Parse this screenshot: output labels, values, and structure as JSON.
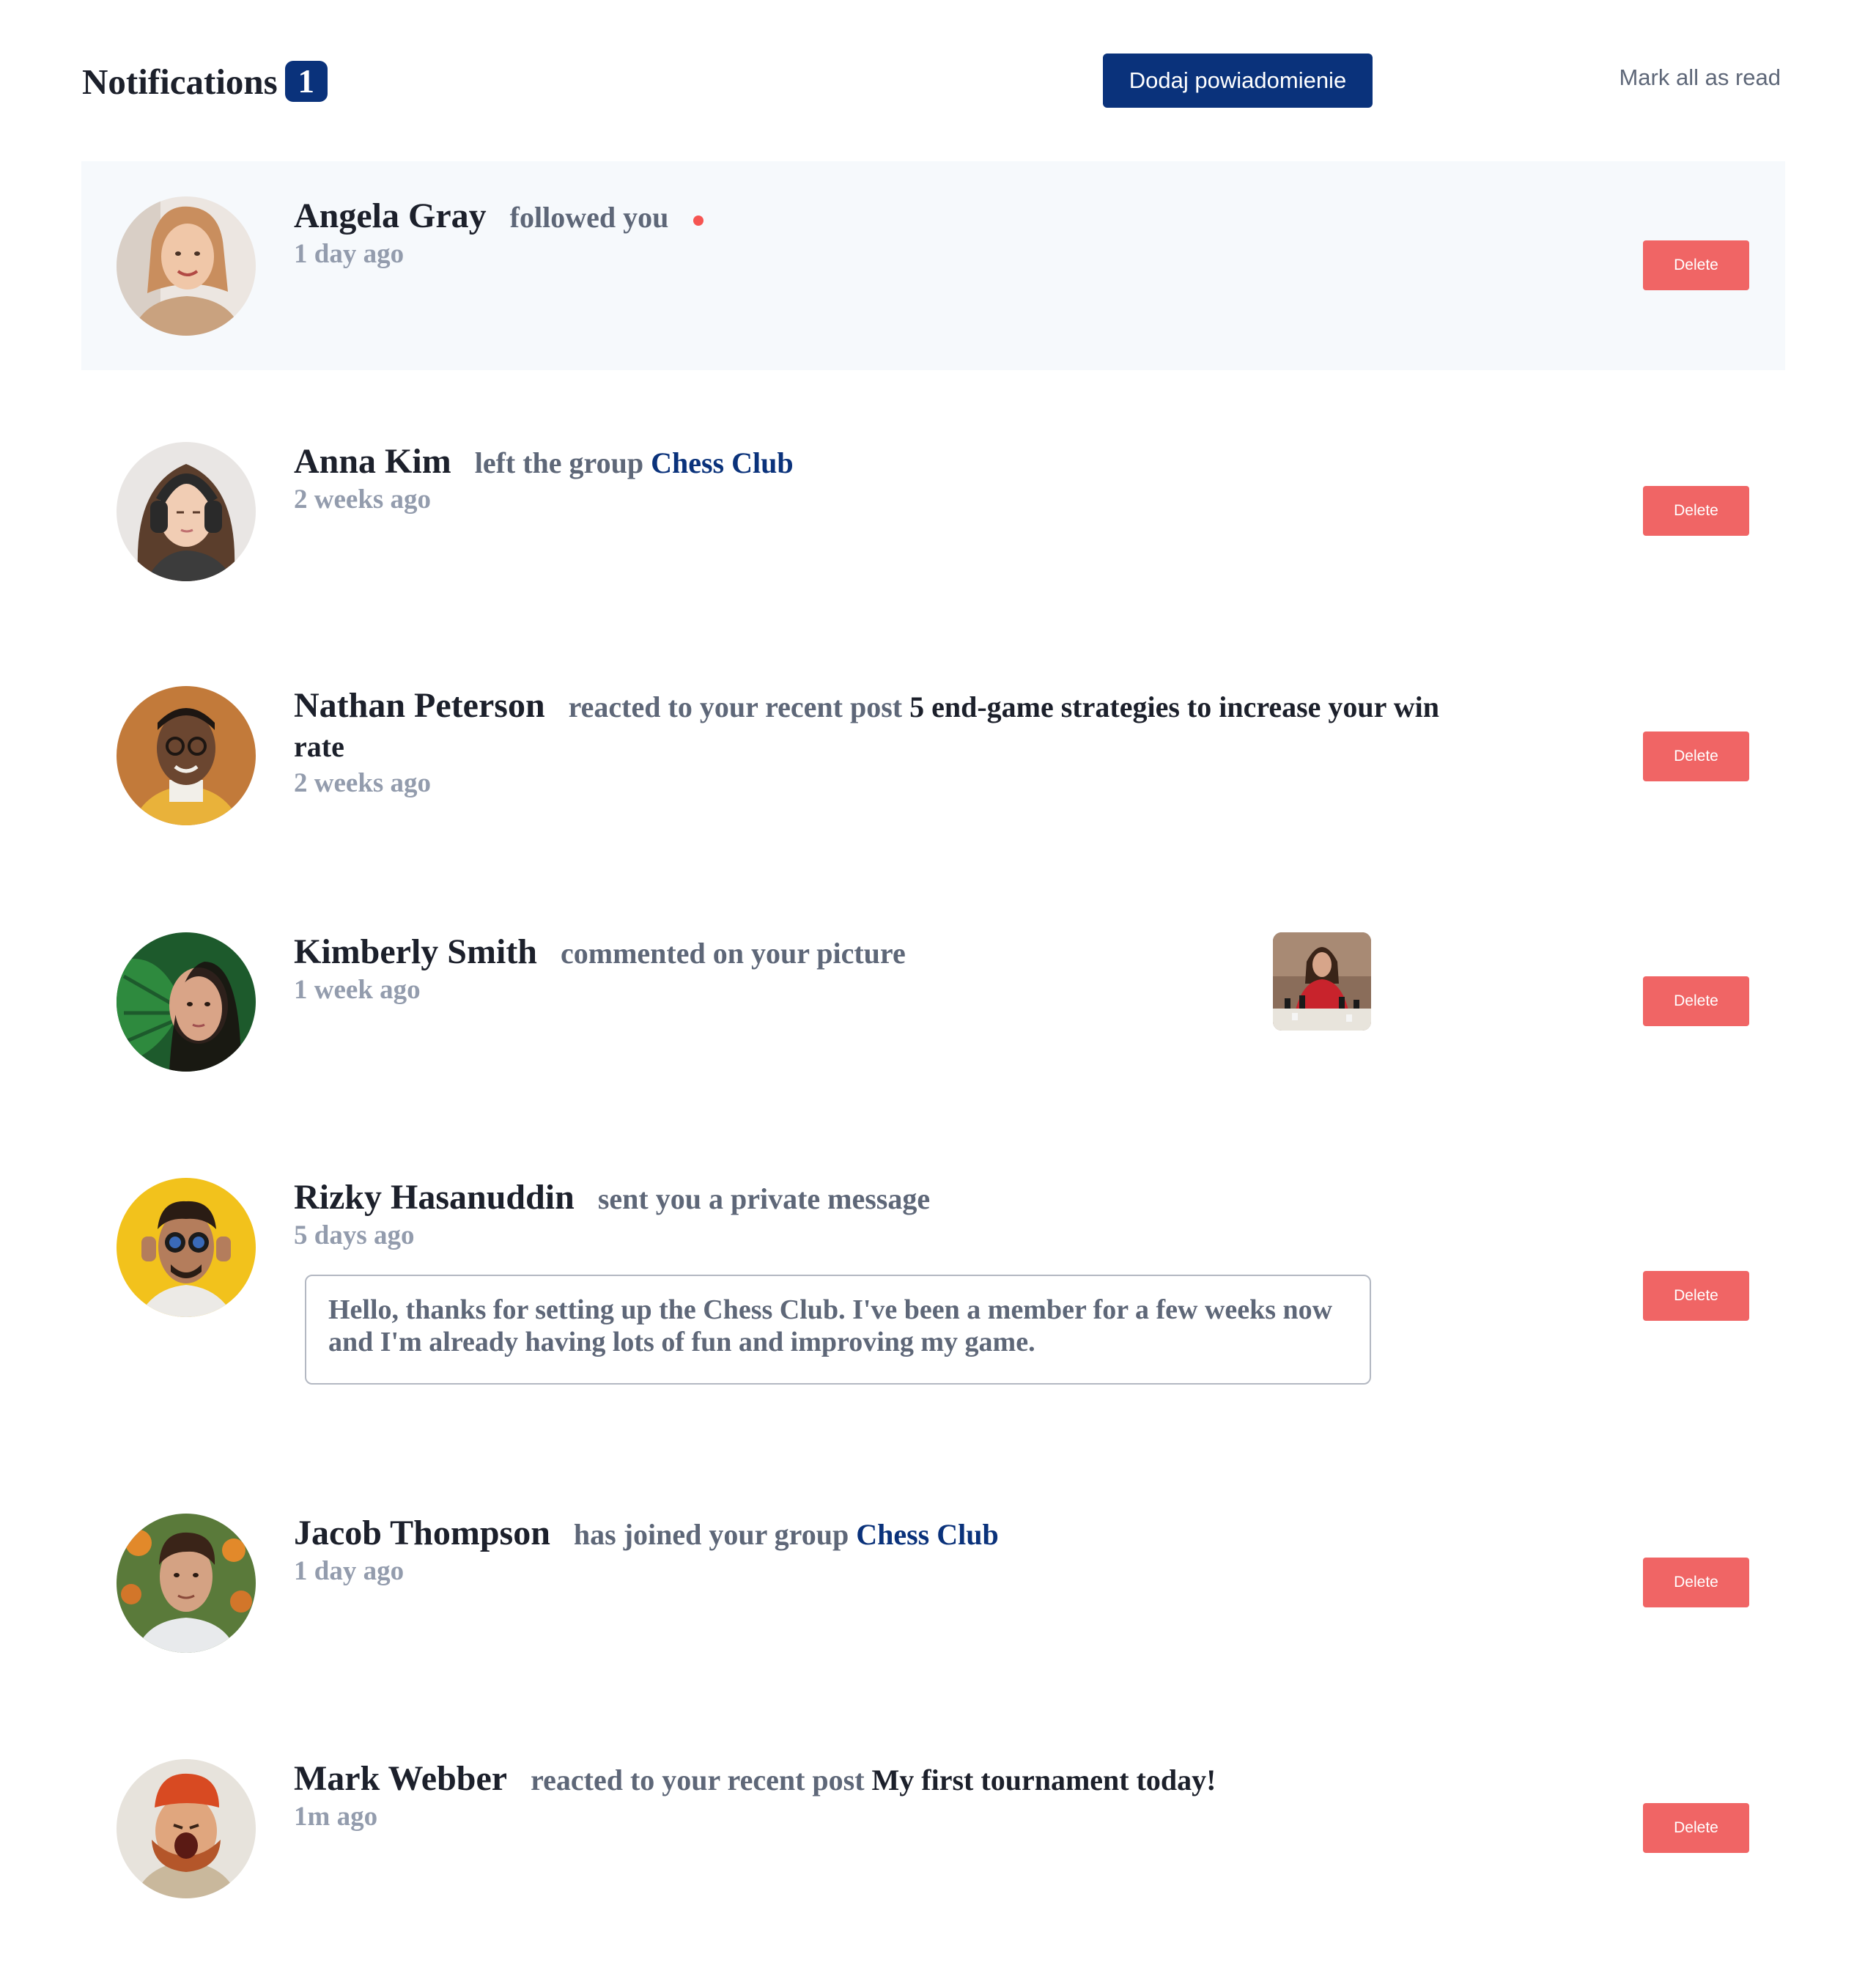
{
  "header": {
    "title": "Notifications",
    "unread_count": "1",
    "add_button_label": "Dodaj powiadomienie",
    "mark_all_label": "Mark all as read"
  },
  "colors": {
    "primary": "#0a327b",
    "delete": "#f06565",
    "unread_bg": "#f6f9fc",
    "unread_dot": "#f65552",
    "muted_text": "#5e6778",
    "time_text": "#939cad"
  },
  "notifications": [
    {
      "name": "Angela Gray",
      "action": "followed you",
      "time": "1 day ago",
      "unread": true,
      "delete_label": "Delete"
    },
    {
      "name": "Anna Kim",
      "action": "left the group",
      "group": "Chess Club",
      "time": "2 weeks ago",
      "delete_label": "Delete"
    },
    {
      "name": "Nathan Peterson",
      "action": "reacted to your recent post",
      "post": "5 end-game strategies to increase your win rate",
      "time": "2 weeks ago",
      "delete_label": "Delete"
    },
    {
      "name": "Kimberly Smith",
      "action": "commented on your picture",
      "time": "1 week ago",
      "delete_label": "Delete"
    },
    {
      "name": "Rizky Hasanuddin",
      "action": "sent you a private message",
      "time": "5 days ago",
      "message": "Hello, thanks for setting up the Chess Club. I've been a member for a few weeks now and I'm already having lots of fun and improving my game.",
      "delete_label": "Delete"
    },
    {
      "name": "Jacob Thompson",
      "action": "has joined your group",
      "group": "Chess Club",
      "time": "1 day ago",
      "delete_label": "Delete"
    },
    {
      "name": "Mark Webber",
      "action": "reacted to your recent post",
      "post": "My first tournament today!",
      "time": "1m ago",
      "delete_label": "Delete"
    }
  ]
}
